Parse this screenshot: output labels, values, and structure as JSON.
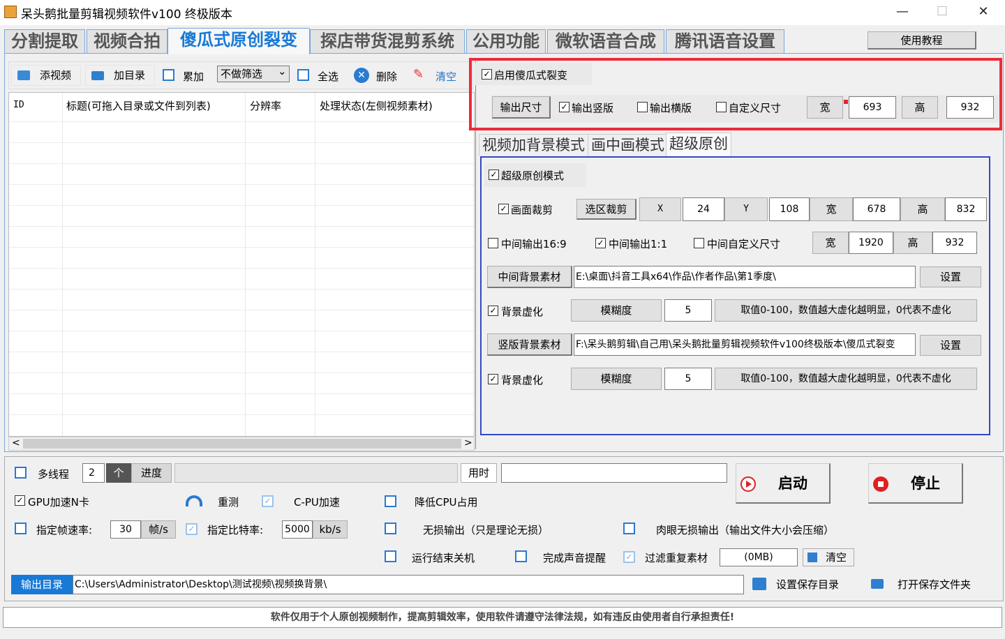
{
  "window": {
    "title": "呆头鹅批量剪辑视频软件v100 终极版本",
    "min": "—",
    "max": "☐",
    "close": "✕"
  },
  "tabs": [
    "分割提取",
    "视频合拍",
    "傻瓜式原创裂变",
    "探店带货混剪系统",
    "公用功能",
    "微软语音合成",
    "腾讯语音设置"
  ],
  "help_button": "使用教程",
  "toolbar": {
    "add_video": "添视频",
    "add_dir": "加目录",
    "accumulate": "累加",
    "filter": "不做筛选",
    "filter_arrow": "⌄",
    "select_all": "全选",
    "delete": "删除",
    "clear": "清空"
  },
  "table": {
    "columns": [
      "ID",
      "标题(可拖入目录或文件到列表)",
      "分辨率",
      "处理状态(左侧视频素材)"
    ],
    "scroll_left": "<",
    "scroll_right": ">"
  },
  "fission": {
    "enable": "启用傻瓜式裂变",
    "output_size_btn": "输出尺寸",
    "output_portrait": "输出竖版",
    "output_landscape": "输出横版",
    "custom_size": "自定义尺寸",
    "width_label": "宽",
    "width_value": "693",
    "height_label": "高",
    "height_value": "932"
  },
  "subtabs": [
    "视频加背景模式",
    "画中画模式",
    "超级原创"
  ],
  "super": {
    "mode": "超级原创模式",
    "crop": "画面裁剪",
    "crop_btn": "选区裁剪",
    "x_label": "X",
    "x_value": "24",
    "y_label": "Y",
    "y_value": "108",
    "w_label": "宽",
    "w_value": "678",
    "h_label": "高",
    "h_value": "832",
    "mid_169": "中间输出16:9",
    "mid_11": "中间输出1:1",
    "mid_custom": "中间自定义尺寸",
    "mw_label": "宽",
    "mw_value": "1920",
    "mh_label": "高",
    "mh_value": "932",
    "mid_bg_btn": "中间背景素材",
    "mid_bg_path": "E:\\桌面\\抖音工具x64\\作品\\作者作品\\第1季度\\",
    "set1": "设置",
    "blur1": "背景虚化",
    "blur_label1": "模糊度",
    "blur_value1": "5",
    "blur_hint1": "取值0-100，数值越大虚化越明显，0代表不虚化",
    "portrait_bg_btn": "竖版背景素材",
    "portrait_bg_path": "F:\\呆头鹅剪辑\\自己用\\呆头鹅批量剪辑视频软件v100终极版本\\傻瓜式裂变",
    "set2": "设置",
    "blur2": "背景虚化",
    "blur_label2": "模糊度",
    "blur_value2": "5",
    "blur_hint2": "取值0-100，数值越大虚化越明显，0代表不虚化"
  },
  "bottom": {
    "multithread": "多线程",
    "thread_value": "2",
    "thread_unit": "个",
    "progress_label": "进度",
    "time_label": "用时",
    "start": "启动",
    "stop": "停止",
    "gpu": "GPU加速N卡",
    "retest": "重测",
    "cpu_accel": "C-PU加速",
    "lower_cpu": "降低CPU占用",
    "fps_label": "指定帧速率:",
    "fps_value": "30",
    "fps_unit": "帧/s",
    "bitrate_label": "指定比特率:",
    "bitrate_value": "5000",
    "bitrate_unit": "kb/s",
    "lossless": "无损输出（只是理论无损）",
    "visual_lossless": "肉眼无损输出（输出文件大小会压缩）",
    "shutdown": "运行结束关机",
    "sound": "完成声音提醒",
    "filter_dup": "过滤重复素材",
    "dup_value": "(0MB)",
    "clear": "清空",
    "output_dir_label": "输出目录",
    "output_dir": "C:\\Users\\Administrator\\Desktop\\测试视频\\视频换背景\\",
    "set_save": "设置保存目录",
    "open_save": "打开保存文件夹"
  },
  "footer": "软件仅用于个人原创视频制作，提高剪辑效率，使用软件请遵守法律法规，如有违反由使用者自行承担责任!"
}
